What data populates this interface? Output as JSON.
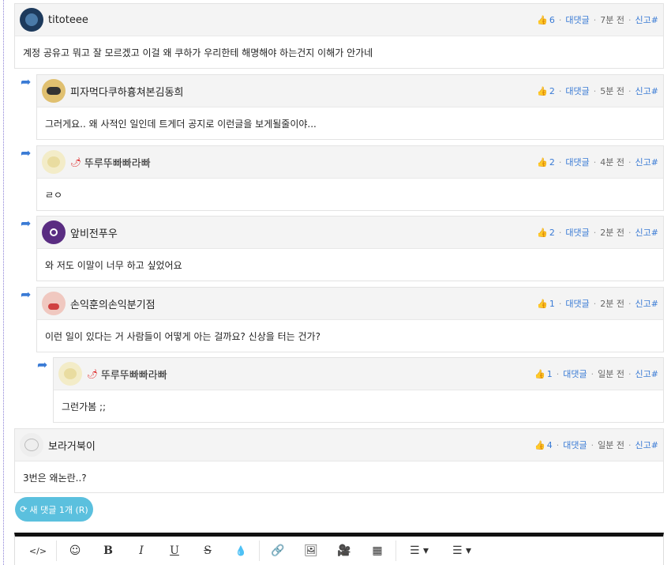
{
  "comments": [
    {
      "name": "titoteee",
      "likes": "6",
      "reply_label": "대댓글",
      "time": "7분 전",
      "report_label": "신고",
      "hash": "#",
      "text": "계정 공유고 뭐고 잘 모르겠고 이걸 왜 쿠하가 우리한테 해명해야 하는건지 이해가 안가네"
    },
    {
      "name": "피자먹다쿠하흉쳐본김동희",
      "likes": "2",
      "reply_label": "대댓글",
      "time": "5분 전",
      "report_label": "신고",
      "hash": "#",
      "text": "그러게요.. 왜 사적인 일인데 트게더 공지로 이런글을 보게될줄이야..."
    },
    {
      "name": "뚜루뚜빠빠라빠",
      "likes": "2",
      "reply_label": "대댓글",
      "time": "4분 전",
      "report_label": "신고",
      "hash": "#",
      "text": "ㄹㅇ"
    },
    {
      "name": "앞비전푸우",
      "likes": "2",
      "reply_label": "대댓글",
      "time": "2분 전",
      "report_label": "신고",
      "hash": "#",
      "text": "와 저도 이말이 너무 하고 싶었어요"
    },
    {
      "name": "손익훈의손익분기점",
      "likes": "1",
      "reply_label": "대댓글",
      "time": "2분 전",
      "report_label": "신고",
      "hash": "#",
      "text": "이런 일이 있다는 거 사람들이 어떻게 아는 걸까요? 신상을 터는 건가?"
    },
    {
      "name": "뚜루뚜빠빠라빠",
      "likes": "1",
      "reply_label": "대댓글",
      "time": "일분 전",
      "report_label": "신고",
      "hash": "#",
      "text": "그런가봄 ;;"
    },
    {
      "name": "보라거북이",
      "likes": "4",
      "reply_label": "대댓글",
      "time": "일분 전",
      "report_label": "신고",
      "hash": "#",
      "text": "3번은 왜논란..?"
    }
  ],
  "new_comments_button": "새 댓글 1개 (R)",
  "toolbar": [
    "code-icon",
    "emoji-icon",
    "bold-icon",
    "italic-icon",
    "underline-icon",
    "strikethrough-icon",
    "color-icon",
    "link-icon",
    "image-icon",
    "video-icon",
    "table-icon",
    "ordered-list-icon",
    "unordered-list-icon"
  ]
}
